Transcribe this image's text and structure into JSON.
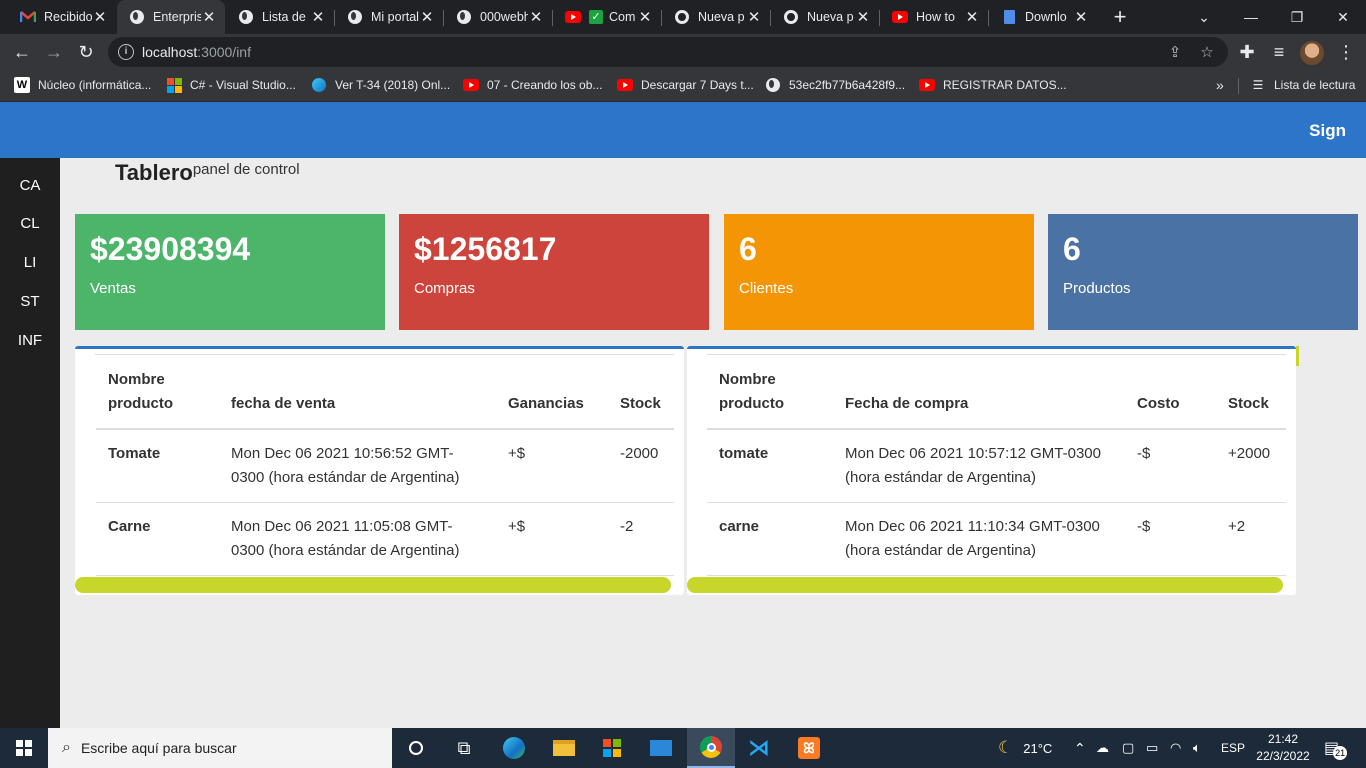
{
  "browser": {
    "tabs": [
      {
        "title": "Recibidos",
        "icon": "gmail-icon",
        "active": false
      },
      {
        "title": "Enterprise",
        "icon": "globe-icon",
        "active": true
      },
      {
        "title": "Lista de",
        "icon": "globe-icon",
        "active": false
      },
      {
        "title": "Mi portal",
        "icon": "globe-icon",
        "active": false
      },
      {
        "title": "000webh",
        "icon": "globe-icon",
        "active": false
      },
      {
        "title": "Com",
        "icon": "youtube-icon",
        "active": false
      },
      {
        "title": "Nueva p",
        "icon": "chrome-icon",
        "active": false
      },
      {
        "title": "Nueva p",
        "icon": "chrome-icon",
        "active": false
      },
      {
        "title": "How to",
        "icon": "youtube-icon",
        "active": false
      },
      {
        "title": "Downlo",
        "icon": "file-icon",
        "active": false
      }
    ],
    "url_host": "localhost",
    "url_path": ":3000/inf",
    "bookmarks": [
      {
        "label": "Núcleo (informática...",
        "icon": "wikipedia-icon"
      },
      {
        "label": "C# - Visual Studio...",
        "icon": "microsoft-icon"
      },
      {
        "label": "Ver T-34 (2018) Onl...",
        "icon": "edge-icon"
      },
      {
        "label": "07 - Creando los ob...",
        "icon": "youtube-icon"
      },
      {
        "label": "Descargar 7 Days t...",
        "icon": "youtube-icon"
      },
      {
        "label": "53ec2fb77b6a428f9...",
        "icon": "globe-icon"
      },
      {
        "label": "REGISTRAR DATOS...",
        "icon": "youtube-icon"
      }
    ],
    "reading_list": "Lista de lectura"
  },
  "app": {
    "nav": {
      "signin": "Sign"
    },
    "sidebar": [
      "CA",
      "CL",
      "LI",
      "ST",
      "INF"
    ],
    "header": {
      "title": "Tablero",
      "subtitle": "panel de control"
    },
    "stats": [
      {
        "value": "$23908394",
        "label": "Ventas",
        "color": "#4cb56a"
      },
      {
        "value": "$1256817",
        "label": "Compras",
        "color": "#cc443c"
      },
      {
        "value": "6",
        "label": "Clientes",
        "color": "#f39505"
      },
      {
        "value": "6",
        "label": "Productos",
        "color": "#4a72a4"
      }
    ],
    "sales_table": {
      "headers": [
        "Nombre producto",
        "fecha de venta",
        "Ganancias",
        "Stock"
      ],
      "rows": [
        [
          "Tomate",
          "Mon Dec 06 2021 10:56:52 GMT-0300 (hora estándar de Argentina)",
          "+$",
          "-2000"
        ],
        [
          "Carne",
          "Mon Dec 06 2021 11:05:08 GMT-0300 (hora estándar de Argentina)",
          "+$",
          "-2"
        ]
      ]
    },
    "purchases_table": {
      "headers": [
        "Nombre producto",
        "Fecha de compra",
        "Costo",
        "Stock"
      ],
      "rows": [
        [
          "tomate",
          "Mon Dec 06 2021 10:57:12 GMT-0300 (hora estándar de Argentina)",
          "-$",
          "+2000"
        ],
        [
          "carne",
          "Mon Dec 06 2021 11:10:34 GMT-0300 (hora estándar de Argentina)",
          "-$",
          "+2"
        ]
      ]
    }
  },
  "taskbar": {
    "search_placeholder": "Escribe aquí para buscar",
    "weather": "21°C",
    "language": "ESP",
    "time": "21:42",
    "date": "22/3/2022",
    "notifications": "21"
  }
}
